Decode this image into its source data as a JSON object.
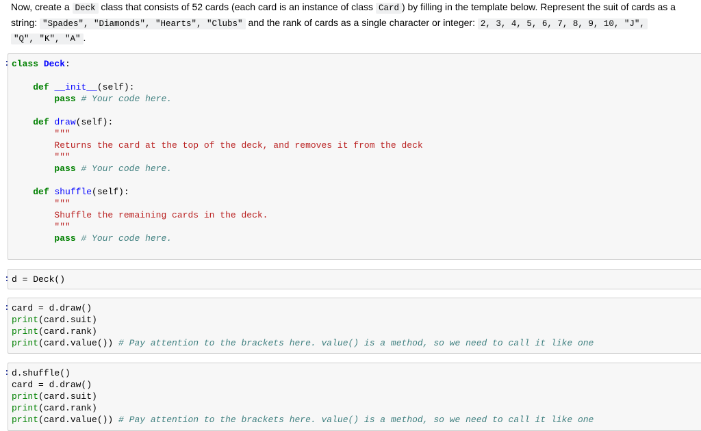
{
  "markdown": {
    "line1_a": "Now, create a ",
    "line1_code1": "Deck",
    "line1_b": " class that consists of 52 cards (each card is an instance of class ",
    "line1_code2": "Card",
    "line1_c": ") by filling in the template below. Represent the suit of cards as a",
    "line2_a": "string: ",
    "line2_code1": "\"Spades\", \"Diamonds\", \"Hearts\", \"Clubs\"",
    "line2_b": " and the rank of cards as a single character or integer: ",
    "line2_code2": "2, 3, 4, 5, 6, 7, 8, 9, 10, \"J\",",
    "line3_code": "\"Q\", \"K\", \"A\"",
    "line3_b": "."
  },
  "cells": [
    {
      "prompt": ":",
      "lines": {
        "class_kw": "class",
        "class_name": "Deck",
        "colon": ":",
        "def": "def",
        "init_name": "__init__",
        "init_args": "(self):",
        "pass": "pass",
        "comment": "# Your code here.",
        "draw_name": "draw",
        "draw_args": "(self):",
        "docquote": "\"\"\"",
        "draw_doc": "Returns the card at the top of the deck, and removes it from the deck",
        "shuffle_name": "shuffle",
        "shuffle_args": "(self):",
        "shuffle_doc": "Shuffle the remaining cards in the deck."
      }
    },
    {
      "prompt": ":",
      "code": "d = Deck()"
    },
    {
      "prompt": ":",
      "lines": {
        "l1": "card = d.draw()",
        "print": "print",
        "l2_args": "(card.suit)",
        "l3_args": "(card.rank)",
        "l4_args": "(card.value())",
        "l4_comment": "# Pay attention to the brackets here. value() is a method, so we need to call it like one"
      }
    },
    {
      "prompt": ":",
      "lines": {
        "l1": "d.shuffle()",
        "l2": "card = d.draw()",
        "print": "print",
        "l3_args": "(card.suit)",
        "l4_args": "(card.rank)",
        "l5_args": "(card.value())",
        "l5_comment": "# Pay attention to the brackets here. value() is a method, so we need to call it like one"
      }
    }
  ]
}
